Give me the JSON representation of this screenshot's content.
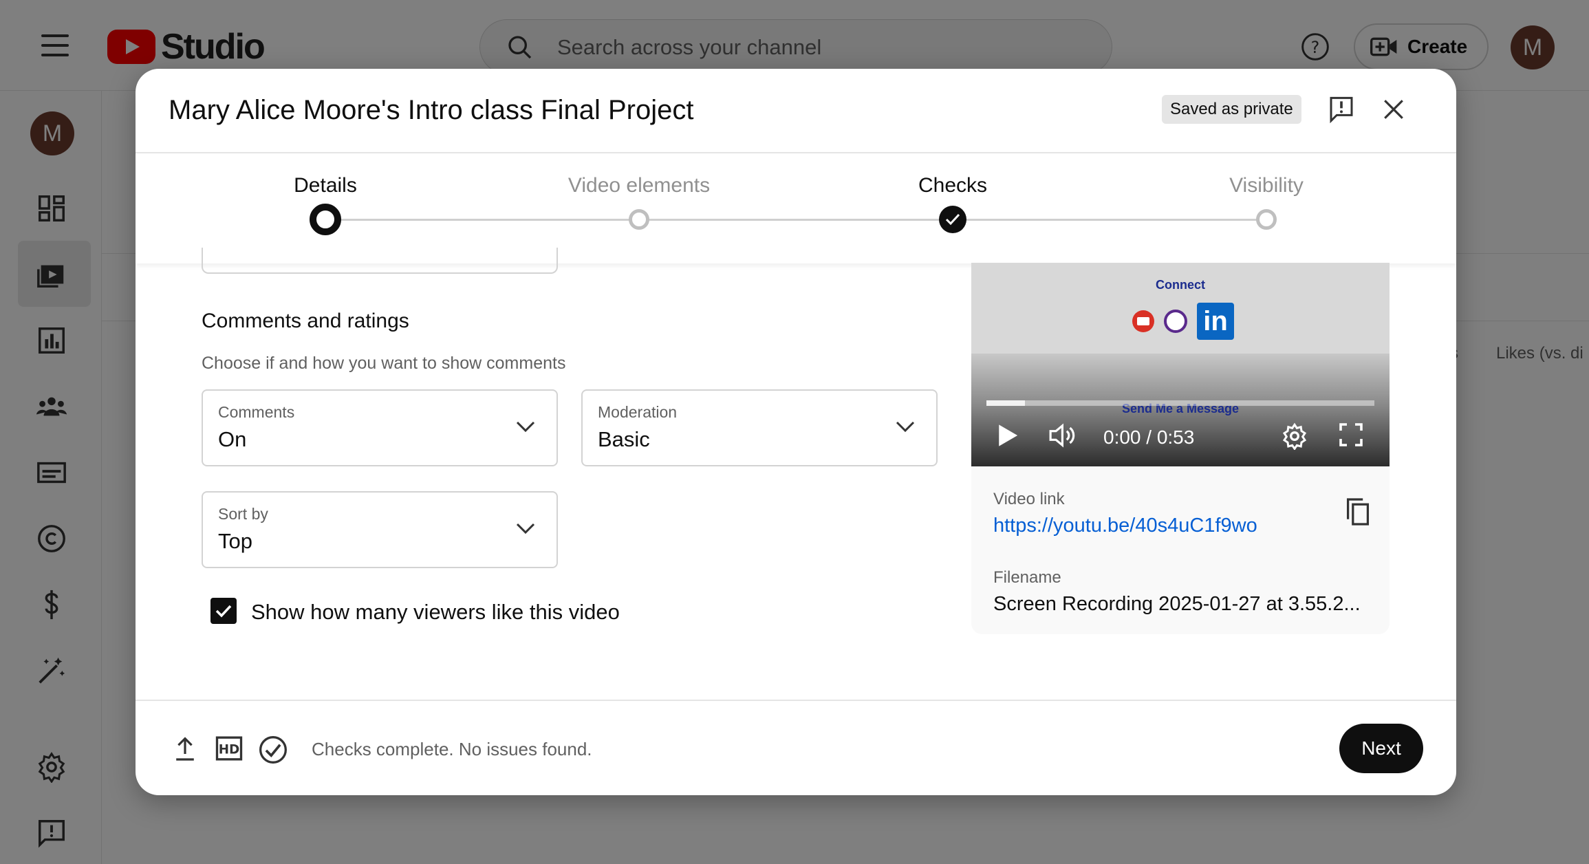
{
  "app": {
    "logo_text": "Studio",
    "search_placeholder": "Search across your channel",
    "create_label": "Create",
    "avatar_initial": "M"
  },
  "background": {
    "column_headers": [
      "s",
      "Likes (vs. di"
    ]
  },
  "dialog": {
    "title": "Mary Alice Moore's Intro class Final Project",
    "saved_badge": "Saved as private",
    "steps": [
      {
        "label": "Details",
        "state": "current"
      },
      {
        "label": "Video elements",
        "state": "pending"
      },
      {
        "label": "Checks",
        "state": "done"
      },
      {
        "label": "Visibility",
        "state": "pending"
      }
    ],
    "comments_section": {
      "title": "Comments and ratings",
      "description": "Choose if and how you want to show comments",
      "comments": {
        "label": "Comments",
        "value": "On"
      },
      "moderation": {
        "label": "Moderation",
        "value": "Basic"
      },
      "sort_by": {
        "label": "Sort by",
        "value": "Top"
      },
      "show_likes": {
        "label": "Show how many viewers like this video",
        "checked": true
      }
    },
    "preview": {
      "video_connect_text": "Connect",
      "video_message_text": "Send Me a Message",
      "linkedin_text": "in",
      "time": "0:00 / 0:53",
      "progress_loaded": 0.1,
      "video_link_label": "Video link",
      "video_link": "https://youtu.be/40s4uC1f9wo",
      "filename_label": "Filename",
      "filename": "Screen Recording 2025-01-27 at 3.55.2..."
    },
    "footer": {
      "status": "Checks complete. No issues found.",
      "next_label": "Next",
      "hd_label": "HD"
    }
  },
  "colors": {
    "accent_link": "#065fd4",
    "brand_red": "#ff0000",
    "primary_button": "#0f0f0f"
  }
}
